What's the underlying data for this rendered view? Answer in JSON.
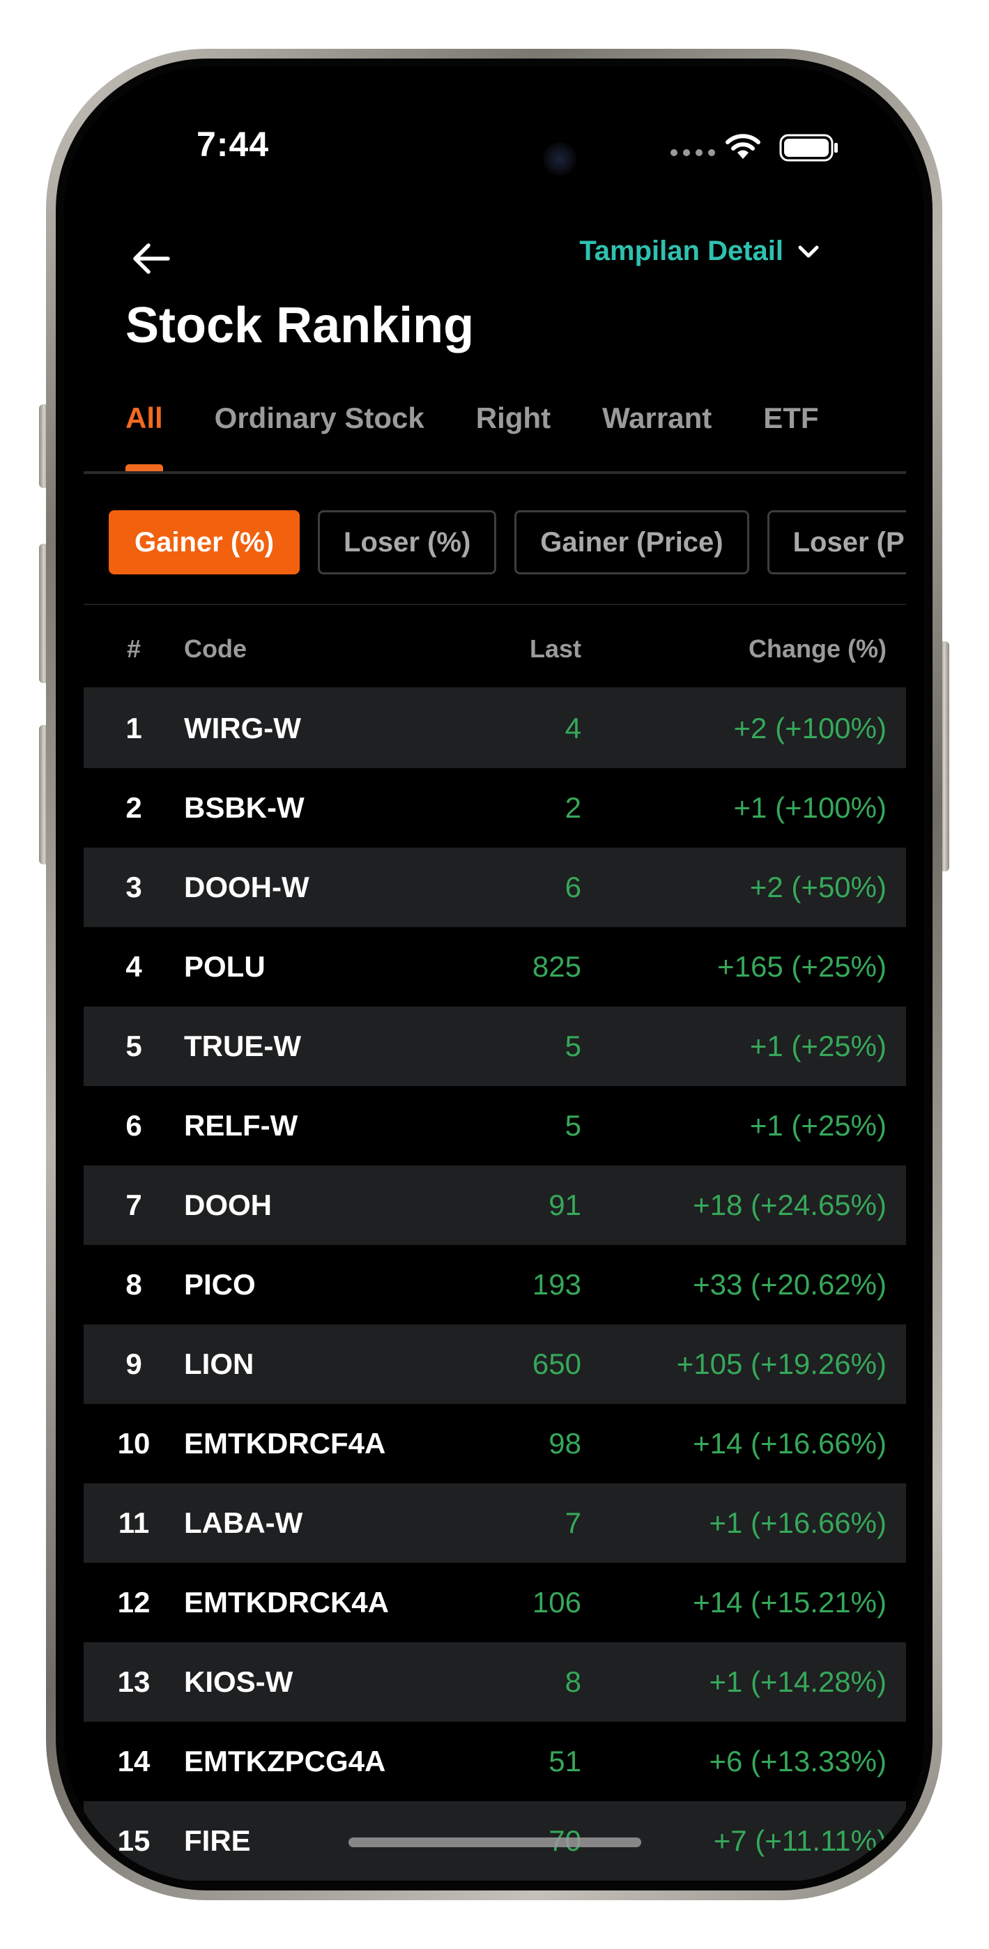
{
  "status_bar": {
    "time": "7:44"
  },
  "header": {
    "view_mode": "Tampilan Detail",
    "title": "Stock Ranking"
  },
  "tabs": [
    {
      "label": "All",
      "active": true
    },
    {
      "label": "Ordinary Stock",
      "active": false
    },
    {
      "label": "Right",
      "active": false
    },
    {
      "label": "Warrant",
      "active": false
    },
    {
      "label": "ETF",
      "active": false
    }
  ],
  "filters": [
    {
      "label": "Gainer (%)",
      "active": true
    },
    {
      "label": "Loser (%)",
      "active": false
    },
    {
      "label": "Gainer (Price)",
      "active": false
    },
    {
      "label": "Loser (Price)",
      "active": false
    }
  ],
  "table": {
    "columns": {
      "rank": "#",
      "code": "Code",
      "last": "Last",
      "change": "Change (%)"
    },
    "rows": [
      {
        "rank": "1",
        "code": "WIRG-W",
        "last": "4",
        "change": "+2 (+100%)"
      },
      {
        "rank": "2",
        "code": "BSBK-W",
        "last": "2",
        "change": "+1 (+100%)"
      },
      {
        "rank": "3",
        "code": "DOOH-W",
        "last": "6",
        "change": "+2 (+50%)"
      },
      {
        "rank": "4",
        "code": "POLU",
        "last": "825",
        "change": "+165 (+25%)"
      },
      {
        "rank": "5",
        "code": "TRUE-W",
        "last": "5",
        "change": "+1 (+25%)"
      },
      {
        "rank": "6",
        "code": "RELF-W",
        "last": "5",
        "change": "+1 (+25%)"
      },
      {
        "rank": "7",
        "code": "DOOH",
        "last": "91",
        "change": "+18 (+24.65%)"
      },
      {
        "rank": "8",
        "code": "PICO",
        "last": "193",
        "change": "+33 (+20.62%)"
      },
      {
        "rank": "9",
        "code": "LION",
        "last": "650",
        "change": "+105 (+19.26%)"
      },
      {
        "rank": "10",
        "code": "EMTKDRCF4A",
        "last": "98",
        "change": "+14 (+16.66%)"
      },
      {
        "rank": "11",
        "code": "LABA-W",
        "last": "7",
        "change": "+1 (+16.66%)"
      },
      {
        "rank": "12",
        "code": "EMTKDRCK4A",
        "last": "106",
        "change": "+14 (+15.21%)"
      },
      {
        "rank": "13",
        "code": "KIOS-W",
        "last": "8",
        "change": "+1 (+14.28%)"
      },
      {
        "rank": "14",
        "code": "EMTKZPCG4A",
        "last": "51",
        "change": "+6 (+13.33%)"
      },
      {
        "rank": "15",
        "code": "FIRE",
        "last": "70",
        "change": "+7 (+11.11%)"
      }
    ]
  },
  "colors": {
    "accent": "#f26a21",
    "positive": "#36a85a",
    "link": "#2fc1b0",
    "row_alt": "#1e2021"
  }
}
